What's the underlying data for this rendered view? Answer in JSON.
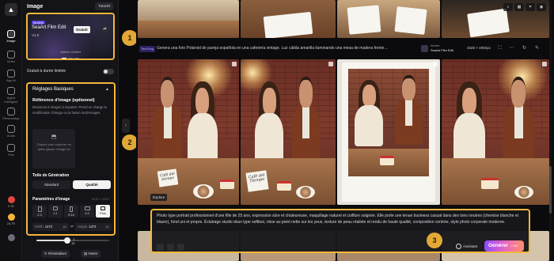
{
  "rail": {
    "items": [
      {
        "label": "Image",
        "icon": "image-icon"
      },
      {
        "label": "Vidéo",
        "icon": "video-icon"
      },
      {
        "label": "App AI",
        "icon": "app-ai-icon"
      },
      {
        "label": "Agent intelligent",
        "icon": "agent-icon"
      },
      {
        "label": "Personnage",
        "icon": "character-icon"
      },
      {
        "label": "Audio",
        "icon": "audio-icon"
      },
      {
        "label": "Plus",
        "icon": "more-icon"
      }
    ],
    "stats": [
      {
        "value": "2.7K",
        "color": "#e0483e"
      },
      {
        "value": "24.7K",
        "color": "#f4b63a"
      }
    ]
  },
  "panel": {
    "title": "Image",
    "tutorial": "Tutoriel",
    "model": {
      "tag": "Modèle",
      "name": "SeaArt Film Edit",
      "version": "V1.0",
      "free_button": "Gratuit",
      "gallery": "Galerie d'idées"
    },
    "free_limited": "Gratuit à durée limitée",
    "basic": {
      "title": "Réglages Basiques",
      "ref_title": "Référence d'image (optionnel)",
      "ref_desc": "Maximum 6 images à importer. Prend en charge la modification d'image ou la fusion multi-images",
      "drop": "Cliquez pour importer ou faites glisser l'image ici",
      "canvas_title": "Toile de Génération",
      "canvas_options": [
        "Standard",
        "Qualité"
      ],
      "params_title": "Paramètres d'image",
      "params_dim": "1472 × 1472",
      "ratios": [
        "2:3",
        "1:1",
        "9:16",
        "4:3",
        "Plus"
      ],
      "width_label": "Width",
      "width_value": "1472",
      "height_label": "Height",
      "height_value": "1472",
      "lock": "⇄",
      "count": "1",
      "count2": "11",
      "quantity_fraction": 0.42
    },
    "reset": "Réinitialiser",
    "notes": "Notes"
  },
  "badges": [
    "1",
    "2",
    "3"
  ],
  "main": {
    "prompt_pill": "Text2Img",
    "prompt": "Genera una foto Polaroid de pareja española en una cafetería vintage. Luz cálida amarilla iluminando una mesa de madera frente…",
    "model_name": "Modèle",
    "model_sub": "SeaArt Film Edit",
    "size": "3328 × 4992px",
    "explore": "Explore",
    "card1": "Café del tiempo",
    "card2": "Café del Tiempo",
    "composer_text": "Photo type portrait professionnel d'une fille de 25 ans, expression sûre et chaleureuse, maquillage naturel et coiffure soignée. Elle porte une tenue business casual dans des tons neutres (chemise blanche et blazer), fond uni et propre. Éclairage studio doux type softbox, mise au point nette sur les yeux, texture de peau réaliste et rendu de haute qualité, composition centrée, style photo corporate moderne.",
    "assistant": "Assistant",
    "generate": "Générer",
    "generate_cost": "+ 100"
  }
}
